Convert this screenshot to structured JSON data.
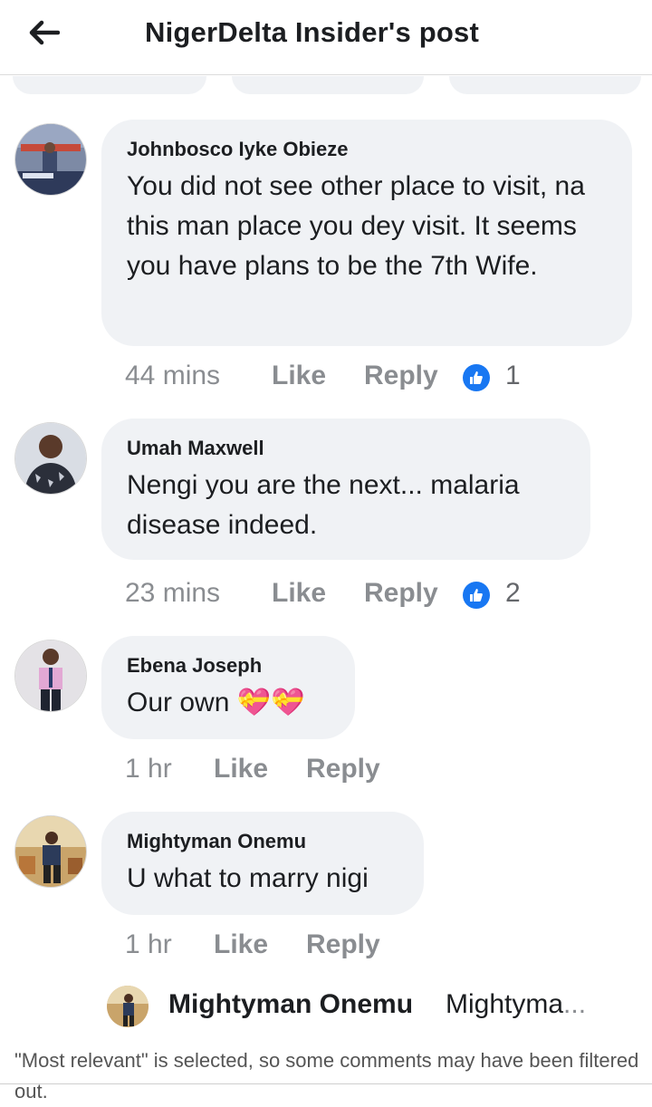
{
  "header": {
    "title": "NigerDelta Insider's post"
  },
  "comments": [
    {
      "author": "Johnbosco Iyke Obieze",
      "text": "You did not see other place to visit, na this man place you dey visit. It seems you have plans to be the 7th Wife.",
      "time": "44 mins",
      "like_label": "Like",
      "reply_label": "Reply",
      "likes": "1"
    },
    {
      "author": "Umah Maxwell",
      "text": "Nengi you are the next... malaria disease indeed.",
      "time": "23 mins",
      "like_label": "Like",
      "reply_label": "Reply",
      "likes": "2"
    },
    {
      "author": "Ebena Joseph",
      "text": "Our own 💝💝",
      "time": "1 hr",
      "like_label": "Like",
      "reply_label": "Reply"
    },
    {
      "author": "Mightyman Onemu",
      "text": "U what to marry nigi",
      "time": "1 hr",
      "like_label": "Like",
      "reply_label": "Reply"
    }
  ],
  "reply_preview": {
    "author": "Mightyman Onemu",
    "snippet": "Mightyma",
    "ellipsis": "..."
  },
  "footer": {
    "note": "\"Most relevant\" is selected, so some comments may have been filtered out."
  },
  "colors": {
    "like_blue": "#1877f2",
    "bubble_bg": "#f0f2f5",
    "meta_gray": "#8a8d91"
  },
  "icons": {
    "back": "arrow-left-icon",
    "like": "thumbs-up-icon"
  }
}
